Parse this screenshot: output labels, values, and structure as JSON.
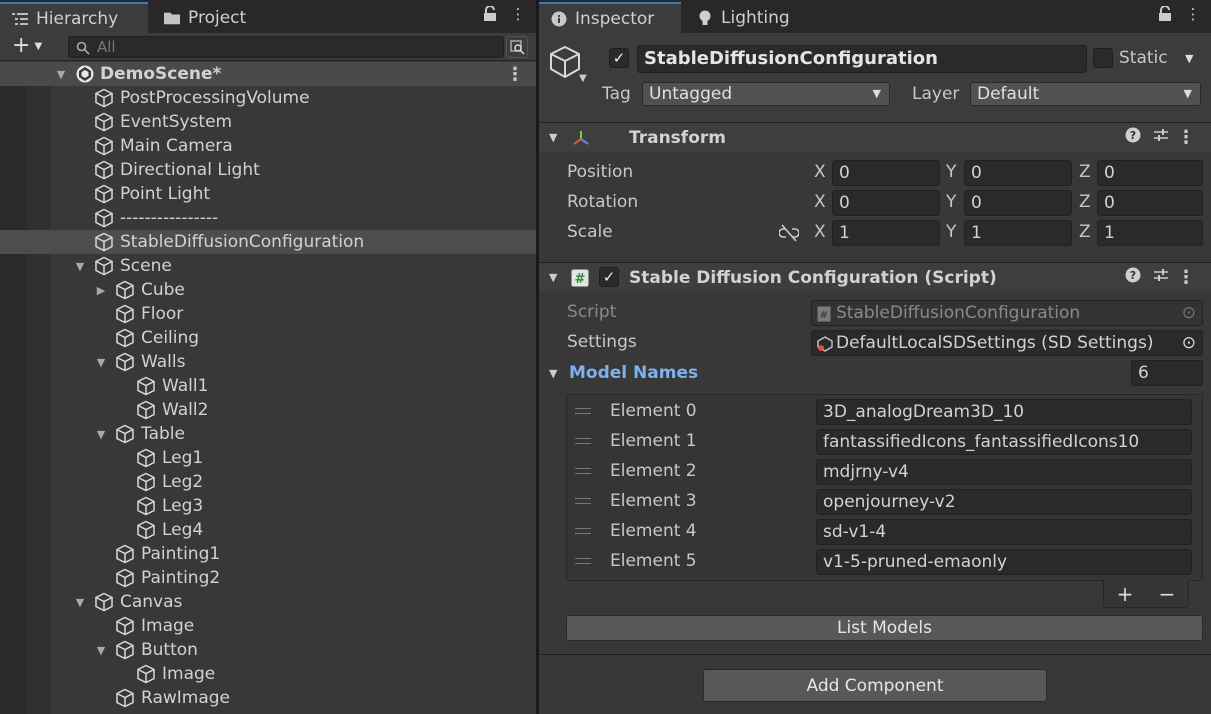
{
  "hierarchy": {
    "tab_label": "Hierarchy",
    "project_tab_label": "Project",
    "search_placeholder": "All",
    "scene_name": "DemoScene*",
    "items": [
      {
        "label": "PostProcessingVolume"
      },
      {
        "label": "EventSystem"
      },
      {
        "label": "Main Camera"
      },
      {
        "label": "Directional Light"
      },
      {
        "label": "Point Light"
      },
      {
        "label": "----------------"
      },
      {
        "label": "StableDiffusionConfiguration"
      },
      {
        "label": "Scene"
      },
      {
        "label": "Cube"
      },
      {
        "label": "Floor"
      },
      {
        "label": "Ceiling"
      },
      {
        "label": "Walls"
      },
      {
        "label": "Wall1"
      },
      {
        "label": "Wall2"
      },
      {
        "label": "Table"
      },
      {
        "label": "Leg1"
      },
      {
        "label": "Leg2"
      },
      {
        "label": "Leg3"
      },
      {
        "label": "Leg4"
      },
      {
        "label": "Painting1"
      },
      {
        "label": "Painting2"
      },
      {
        "label": "Canvas"
      },
      {
        "label": "Image"
      },
      {
        "label": "Button"
      },
      {
        "label": "Image"
      },
      {
        "label": "RawImage"
      }
    ]
  },
  "inspector": {
    "tab_label": "Inspector",
    "lighting_tab_label": "Lighting",
    "object_name": "StableDiffusionConfiguration",
    "static_label": "Static",
    "tag_label": "Tag",
    "tag_value": "Untagged",
    "layer_label": "Layer",
    "layer_value": "Default",
    "transform": {
      "title": "Transform",
      "position_label": "Position",
      "rotation_label": "Rotation",
      "scale_label": "Scale",
      "x": "X",
      "y": "Y",
      "z": "Z",
      "position": [
        "0",
        "0",
        "0"
      ],
      "rotation": [
        "0",
        "0",
        "0"
      ],
      "scale": [
        "1",
        "1",
        "1"
      ]
    },
    "script_component": {
      "title": "Stable Diffusion Configuration (Script)",
      "script_label": "Script",
      "script_value": "StableDiffusionConfiguration",
      "settings_label": "Settings",
      "settings_value": "DefaultLocalSDSettings (SD Settings)",
      "model_names_label": "Model Names",
      "model_count": "6",
      "elements": [
        {
          "label": "Element 0",
          "value": "3D_analogDream3D_10"
        },
        {
          "label": "Element 1",
          "value": "fantassifiedIcons_fantassifiedIcons10"
        },
        {
          "label": "Element 2",
          "value": "mdjrny-v4"
        },
        {
          "label": "Element 3",
          "value": "openjourney-v2"
        },
        {
          "label": "Element 4",
          "value": "sd-v1-4"
        },
        {
          "label": "Element 5",
          "value": "v1-5-pruned-emaonly"
        }
      ],
      "add_symbol": "+",
      "remove_symbol": "−",
      "list_models_label": "List Models"
    },
    "add_component_label": "Add Component"
  }
}
